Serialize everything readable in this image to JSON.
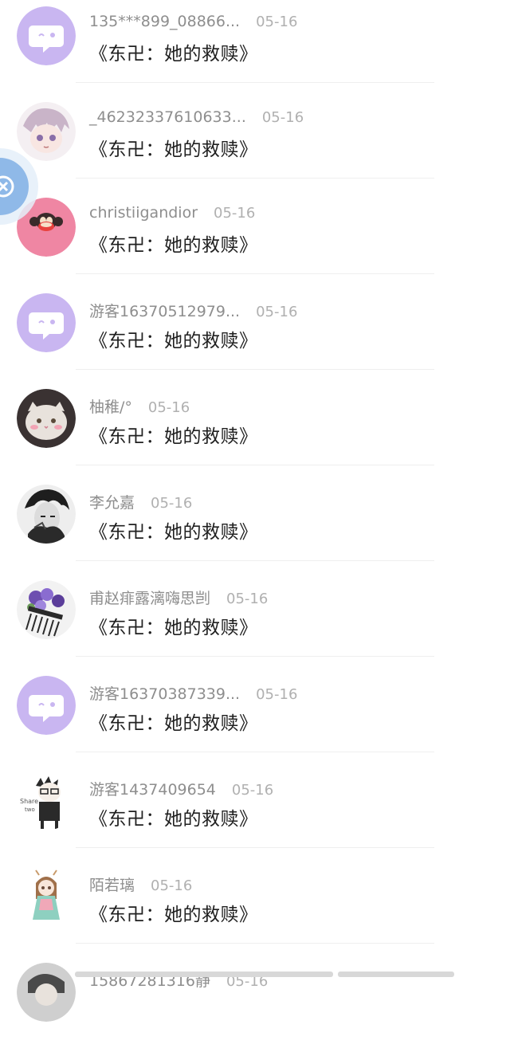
{
  "comments": [
    {
      "name": "135***899_08866...",
      "date": "05-16",
      "title": "《东卍：她的救赎》",
      "avatar": "default-chat-avatar"
    },
    {
      "name": "_46232337610633...",
      "date": "05-16",
      "title": "《东卍：她的救赎》",
      "avatar": "anime-girl-avatar"
    },
    {
      "name": "christiigandior",
      "date": "05-16",
      "title": "《东卍：她的救赎》",
      "avatar": "monkey-avatar"
    },
    {
      "name": "游客16370512979...",
      "date": "05-16",
      "title": "《东卍：她的救赎》",
      "avatar": "default-chat-avatar"
    },
    {
      "name": "柚稚/°",
      "date": "05-16",
      "title": "《东卍：她的救赎》",
      "avatar": "cat-avatar"
    },
    {
      "name": "李允嘉",
      "date": "05-16",
      "title": "《东卍：她的救赎》",
      "avatar": "sketch-portrait-avatar"
    },
    {
      "name": "甫赵痱露漓嗨思剀",
      "date": "05-16",
      "title": "《东卍：她的救赎》",
      "avatar": "flower-comb-avatar"
    },
    {
      "name": "游客16370387339...",
      "date": "05-16",
      "title": "《东卍：她的救赎》",
      "avatar": "default-chat-avatar"
    },
    {
      "name": "游客1437409654",
      "date": "05-16",
      "title": "《东卍：她的救赎》",
      "avatar": "chibi-boy-avatar"
    },
    {
      "name": "陌若璃",
      "date": "05-16",
      "title": "《东卍：她的救赎》",
      "avatar": "chibi-girl-avatar"
    },
    {
      "name": "15867281316静",
      "date": "05-16",
      "title": "",
      "avatar": "partial-avatar"
    }
  ],
  "float_button": {
    "icon": "close-icon"
  },
  "colors": {
    "default_avatar_bg": "#c9b6f1",
    "monkey_bg": "#ef86a3",
    "float_button": "#8fb9e8"
  }
}
